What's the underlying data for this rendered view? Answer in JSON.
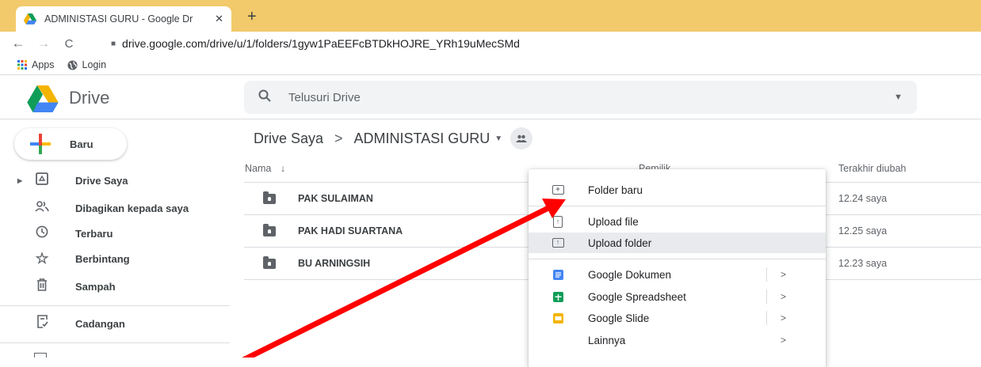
{
  "browser": {
    "tab_title": "ADMINISTASI GURU - Google Dr",
    "tab_close": "✕",
    "new_tab": "+",
    "back": "←",
    "forward": "→",
    "reload": "C",
    "url": "drive.google.com/drive/u/1/folders/1gyw1PaEEFcBTDkHOJRE_YRh19uMecSMd",
    "bookmarks": [
      {
        "label": "Apps",
        "icon": "apps-grid-icon"
      },
      {
        "label": "Login",
        "icon": "globe-icon"
      }
    ]
  },
  "header": {
    "app_name": "Drive",
    "search_placeholder": "Telusuri Drive"
  },
  "sidebar": {
    "new_label": "Baru",
    "items": [
      {
        "label": "Drive Saya",
        "icon": "my-drive-icon"
      },
      {
        "label": "Dibagikan kepada saya",
        "icon": "shared-people-icon"
      },
      {
        "label": "Terbaru",
        "icon": "clock-icon"
      },
      {
        "label": "Berbintang",
        "icon": "star-icon"
      },
      {
        "label": "Sampah",
        "icon": "trash-icon"
      },
      {
        "label": "Cadangan",
        "icon": "backup-icon"
      }
    ]
  },
  "breadcrumb": {
    "root": "Drive Saya",
    "separator": ">",
    "current": "ADMINISTASI GURU"
  },
  "table": {
    "col_name": "Nama",
    "col_owner": "Pemilik",
    "col_modified": "Terakhir diubah",
    "rows": [
      {
        "name": "PAK SULAIMAN",
        "modified": "12.24 saya"
      },
      {
        "name": "PAK HADI SUARTANA",
        "modified": "12.25 saya"
      },
      {
        "name": "BU ARNINGSIH",
        "modified": "12.23 saya"
      }
    ]
  },
  "context_menu": {
    "items": [
      {
        "label": "Folder baru",
        "icon": "new-folder-icon"
      },
      {
        "label": "Upload file",
        "icon": "upload-file-icon"
      },
      {
        "label": "Upload folder",
        "icon": "upload-folder-icon"
      },
      {
        "label": "Google Dokumen",
        "icon": "google-docs-icon",
        "submenu": ">"
      },
      {
        "label": "Google Spreadsheet",
        "icon": "google-sheets-icon",
        "submenu": ">"
      },
      {
        "label": "Google Slide",
        "icon": "google-slides-icon",
        "submenu": ">"
      },
      {
        "label": "Lainnya",
        "icon": "",
        "submenu": ">"
      }
    ],
    "highlighted": "Upload folder"
  },
  "colors": {
    "tabbar": "#f2ca6b",
    "docs_blue": "#4285f4",
    "sheets_green": "#0f9d58",
    "slides_yellow": "#f4b400",
    "annotation_red": "#ff0000"
  }
}
